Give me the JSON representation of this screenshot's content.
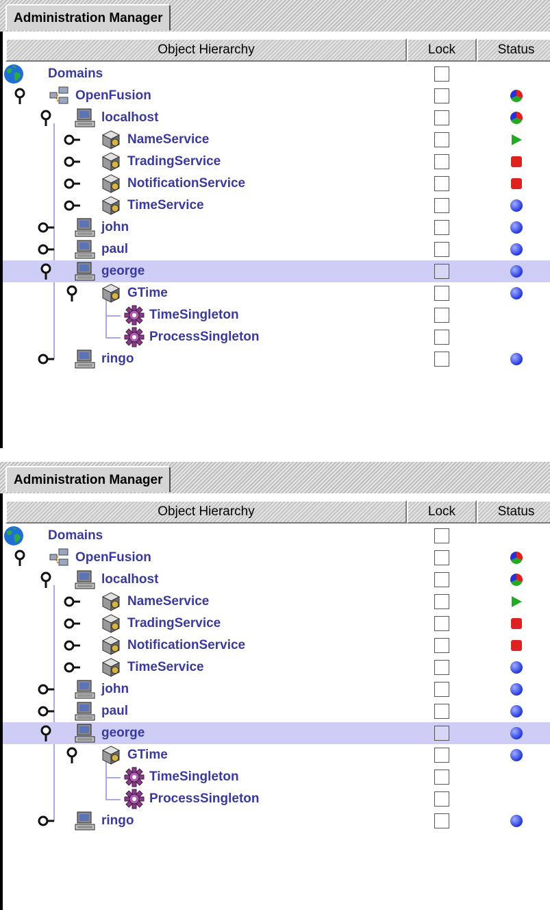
{
  "panels": [
    {
      "tab_label": "Administration Manager",
      "columns": {
        "hierarchy": "Object Hierarchy",
        "lock": "Lock",
        "status": "Status"
      },
      "rows": [
        {
          "label": "Domains",
          "icon": "globe-icon",
          "handle": "none",
          "status": "none",
          "locked": false,
          "selected": false
        },
        {
          "label": "OpenFusion",
          "icon": "domain-icon",
          "handle": "expanded",
          "status": "mixed",
          "locked": false,
          "selected": false
        },
        {
          "label": "localhost",
          "icon": "computer-icon",
          "handle": "expanded",
          "status": "mixed",
          "locked": false,
          "selected": false
        },
        {
          "label": "NameService",
          "icon": "service-icon",
          "handle": "collapsed",
          "status": "running",
          "locked": false,
          "selected": false
        },
        {
          "label": "TradingService",
          "icon": "service-icon",
          "handle": "collapsed",
          "status": "stopped",
          "locked": false,
          "selected": false
        },
        {
          "label": "NotificationService",
          "icon": "service-icon",
          "handle": "collapsed",
          "status": "stopped",
          "locked": false,
          "selected": false
        },
        {
          "label": "TimeService",
          "icon": "service-icon",
          "handle": "collapsed",
          "status": "idle",
          "locked": false,
          "selected": false
        },
        {
          "label": "john",
          "icon": "computer-icon",
          "handle": "collapsed",
          "status": "idle",
          "locked": false,
          "selected": false
        },
        {
          "label": "paul",
          "icon": "computer-icon",
          "handle": "collapsed",
          "status": "idle",
          "locked": false,
          "selected": false
        },
        {
          "label": "george",
          "icon": "computer-icon",
          "handle": "expanded",
          "status": "idle",
          "locked": false,
          "selected": true
        },
        {
          "label": "GTime",
          "icon": "service-icon",
          "handle": "expanded",
          "status": "idle",
          "locked": false,
          "selected": false
        },
        {
          "label": "TimeSingleton",
          "icon": "singleton-icon",
          "handle": "none",
          "status": "none",
          "locked": false,
          "selected": false
        },
        {
          "label": "ProcessSingleton",
          "icon": "singleton-icon",
          "handle": "none",
          "status": "none",
          "locked": false,
          "selected": false
        },
        {
          "label": "ringo",
          "icon": "computer-icon",
          "handle": "collapsed",
          "status": "idle",
          "locked": false,
          "selected": false
        }
      ]
    },
    {
      "tab_label": "Administration Manager",
      "columns": {
        "hierarchy": "Object Hierarchy",
        "lock": "Lock",
        "status": "Status"
      },
      "rows": [
        {
          "label": "Domains",
          "icon": "globe-icon",
          "handle": "none",
          "status": "none",
          "locked": false,
          "selected": false
        },
        {
          "label": "OpenFusion",
          "icon": "domain-icon",
          "handle": "expanded",
          "status": "mixed",
          "locked": false,
          "selected": false
        },
        {
          "label": "localhost",
          "icon": "computer-icon",
          "handle": "expanded",
          "status": "mixed",
          "locked": false,
          "selected": false
        },
        {
          "label": "NameService",
          "icon": "service-icon",
          "handle": "collapsed",
          "status": "running",
          "locked": false,
          "selected": false
        },
        {
          "label": "TradingService",
          "icon": "service-icon",
          "handle": "collapsed",
          "status": "stopped",
          "locked": false,
          "selected": false
        },
        {
          "label": "NotificationService",
          "icon": "service-icon",
          "handle": "collapsed",
          "status": "stopped",
          "locked": false,
          "selected": false
        },
        {
          "label": "TimeService",
          "icon": "service-icon",
          "handle": "collapsed",
          "status": "idle",
          "locked": false,
          "selected": false
        },
        {
          "label": "john",
          "icon": "computer-icon",
          "handle": "collapsed",
          "status": "idle",
          "locked": false,
          "selected": false
        },
        {
          "label": "paul",
          "icon": "computer-icon",
          "handle": "collapsed",
          "status": "idle",
          "locked": false,
          "selected": false
        },
        {
          "label": "george",
          "icon": "computer-icon",
          "handle": "expanded",
          "status": "idle",
          "locked": false,
          "selected": true
        },
        {
          "label": "GTime",
          "icon": "service-icon",
          "handle": "expanded",
          "status": "idle",
          "locked": false,
          "selected": false
        },
        {
          "label": "TimeSingleton",
          "icon": "singleton-icon",
          "handle": "none",
          "status": "none",
          "locked": false,
          "selected": false
        },
        {
          "label": "ProcessSingleton",
          "icon": "singleton-icon",
          "handle": "none",
          "status": "none",
          "locked": false,
          "selected": false
        },
        {
          "label": "ringo",
          "icon": "computer-icon",
          "handle": "collapsed",
          "status": "idle",
          "locked": false,
          "selected": false
        }
      ]
    }
  ],
  "colors": {
    "label_text": "#3a3a9e",
    "selection": "#cdcdf5",
    "tree_line": "#a9a9de",
    "status_running": "#22aa22",
    "status_stopped": "#dd2222",
    "status_idle": "#2233dd"
  }
}
